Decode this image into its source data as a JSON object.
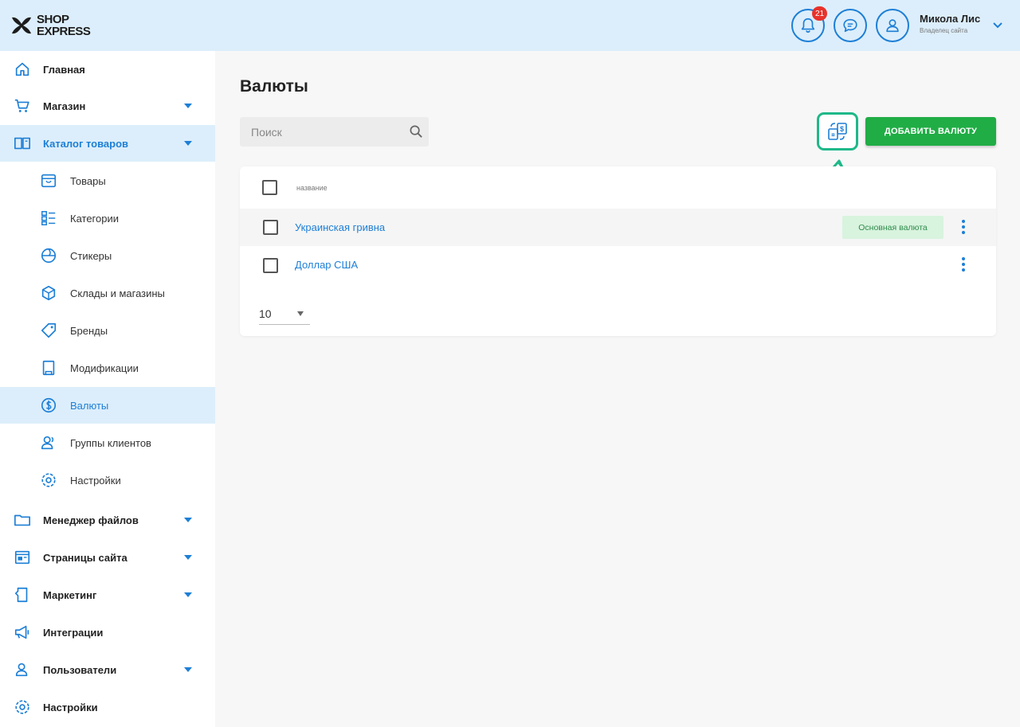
{
  "app": {
    "logo_line1": "SHOP",
    "logo_line2": "EXPRESS"
  },
  "header": {
    "notifications_count": "21",
    "user_name": "Микола Лис",
    "user_role": "Владелец сайта"
  },
  "sidebar": {
    "items": [
      {
        "label": "Главная"
      },
      {
        "label": "Магазин"
      },
      {
        "label": "Каталог товаров"
      },
      {
        "label": "Товары"
      },
      {
        "label": "Категории"
      },
      {
        "label": "Стикеры"
      },
      {
        "label": "Склады и магазины"
      },
      {
        "label": "Бренды"
      },
      {
        "label": "Модификации"
      },
      {
        "label": "Валюты"
      },
      {
        "label": "Группы клиентов"
      },
      {
        "label": "Настройки"
      },
      {
        "label": "Менеджер файлов"
      },
      {
        "label": "Страницы сайта"
      },
      {
        "label": "Маркетинг"
      },
      {
        "label": "Интеграции"
      },
      {
        "label": "Пользователи"
      },
      {
        "label": "Настройки"
      }
    ]
  },
  "main": {
    "title": "Валюты",
    "search_placeholder": "Поиск",
    "add_button": "ДОБАВИТЬ ВАЛЮТУ",
    "table": {
      "header": "название",
      "rows": [
        {
          "name": "Украинская гривна",
          "badge": "Основная валюта"
        },
        {
          "name": "Доллар США"
        }
      ]
    },
    "per_page": "10"
  },
  "colors": {
    "accent": "#1d7fd6",
    "header_bg": "#dceefb",
    "add_button": "#20ad45",
    "highlight": "#1fb889",
    "badge_bg": "#d8f3de"
  }
}
